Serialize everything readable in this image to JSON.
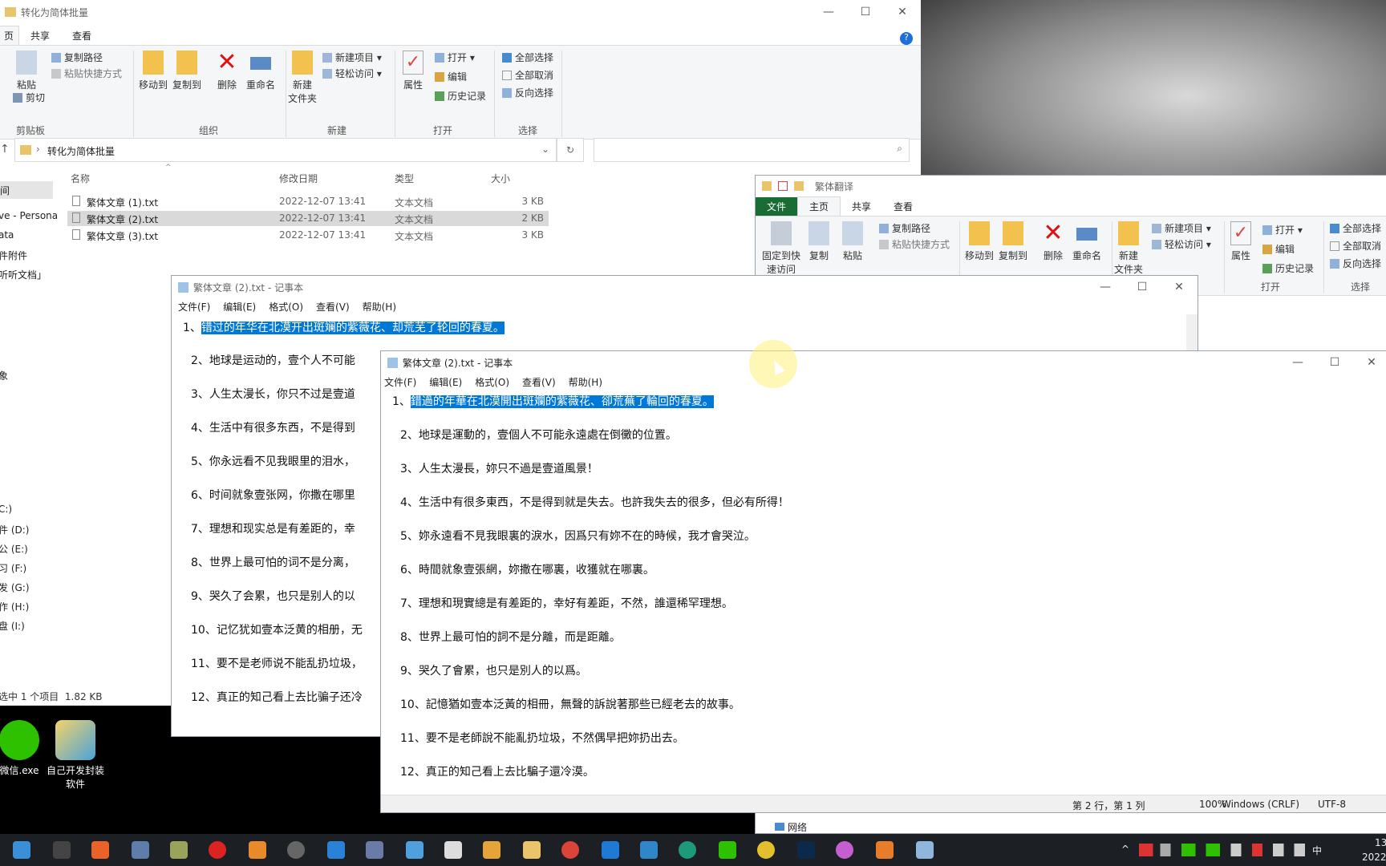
{
  "explorer_main": {
    "title": "转化为简体批量",
    "tabs": [
      "页",
      "共享",
      "查看"
    ],
    "ribbon": {
      "clipboard": {
        "copy_path": "复制路径",
        "paste_shortcut": "粘贴快捷方式",
        "paste": "粘贴",
        "cut": "剪切",
        "group": "剪贴板"
      },
      "organize": {
        "move_to": "移动到",
        "copy_to": "复制到",
        "delete": "删除",
        "rename": "重命名",
        "group": "组织"
      },
      "new": {
        "new_folder_1": "新建",
        "new_folder_2": "文件夹",
        "new_item": "新建项目",
        "easy_access": "轻松访问",
        "group": "新建"
      },
      "open": {
        "properties": "属性",
        "open": "打开",
        "edit": "编辑",
        "history": "历史记录",
        "group": "打开"
      },
      "select": {
        "select_all": "全部选择",
        "select_none": "全部取消",
        "invert": "反向选择",
        "group": "选择"
      }
    },
    "address": "转化为简体批量",
    "columns": {
      "name": "名称",
      "date": "修改日期",
      "type": "类型",
      "size": "大小"
    },
    "files": [
      {
        "name": "繁体文章 (1).txt",
        "date": "2022-12-07 13:41",
        "type": "文本文档",
        "size": "3 KB"
      },
      {
        "name": "繁体文章 (2).txt",
        "date": "2022-12-07 13:41",
        "type": "文本文档",
        "size": "2 KB"
      },
      {
        "name": "繁体文章 (3).txt",
        "date": "2022-12-07 13:41",
        "type": "文本文档",
        "size": "3 KB"
      }
    ],
    "nav": [
      "间",
      "ve - Persona",
      "ata",
      "件附件",
      "听听文档」",
      "象",
      "C:)",
      "件 (D:)",
      "公 (E:)",
      "习 (F:)",
      "发 (G:)",
      "作 (H:)",
      "盘 (I:)"
    ],
    "status": "选中 1 个项目  1.82 KB"
  },
  "explorer_second": {
    "title": "繁体翻译",
    "tabs": [
      "文件",
      "主页",
      "共享",
      "查看"
    ],
    "ribbon": {
      "pin": "固定到快",
      "pin2": "速访问",
      "copy": "复制",
      "paste": "粘贴",
      "copy_path": "复制路径",
      "paste_shortcut": "粘贴快捷方式",
      "move_to": "移动到",
      "copy_to": "复制到",
      "delete": "删除",
      "rename": "重命名",
      "new_folder": "新建",
      "new_folder2": "文件夹",
      "new_item": "新建项目",
      "easy_access": "轻松访问",
      "properties": "属性",
      "open": "打开",
      "edit": "编辑",
      "history": "历史记录",
      "group_open": "打开",
      "select_all": "全部选择",
      "select_none": "全部取消",
      "invert": "反向选择",
      "group_select": "选择"
    },
    "network": "网络"
  },
  "notepad_back": {
    "title": "繁体文章 (2).txt - 记事本",
    "menu": [
      "文件(F)",
      "编辑(E)",
      "格式(O)",
      "查看(V)",
      "帮助(H)"
    ],
    "lines": [
      {
        "num": "1、",
        "text": "错过的年华在北漠开出斑斓的紫薇花、却荒芜了轮回的春夏。"
      },
      {
        "num": "2、",
        "text": "地球是运动的，壹个人不可能"
      },
      {
        "num": "3、",
        "text": "人生太漫长，你只不过是壹道"
      },
      {
        "num": "4、",
        "text": "生活中有很多东西，不是得到"
      },
      {
        "num": "5、",
        "text": "你永远看不见我眼里的泪水，"
      },
      {
        "num": "6、",
        "text": "时间就象壹张网，你撒在哪里"
      },
      {
        "num": "7、",
        "text": "理想和现实总是有差距的，幸"
      },
      {
        "num": "8、",
        "text": "世界上最可怕的词不是分离，"
      },
      {
        "num": "9、",
        "text": "哭久了会累，也只是别人的以"
      },
      {
        "num": "10、",
        "text": "记忆犹如壹本泛黄的相册，无"
      },
      {
        "num": "11、",
        "text": "要不是老师说不能乱扔垃圾，"
      },
      {
        "num": "12、",
        "text": "真正的知己看上去比骗子还冷"
      }
    ]
  },
  "notepad_front": {
    "title": "繁体文章 (2).txt - 记事本",
    "menu": [
      "文件(F)",
      "编辑(E)",
      "格式(O)",
      "查看(V)",
      "帮助(H)"
    ],
    "lines": [
      {
        "num": "1、",
        "text": "錯過的年華在北漠開出斑斕的紫薇花、卻荒蕪了輪回的春夏。"
      },
      {
        "num": "2、",
        "text": "地球是運動的，壹個人不可能永遠處在倒黴的位置。"
      },
      {
        "num": "3、",
        "text": "人生太漫長，妳只不過是壹道風景！"
      },
      {
        "num": "4、",
        "text": "生活中有很多東西，不是得到就是失去。也許我失去的很多，但必有所得！"
      },
      {
        "num": "5、",
        "text": "妳永遠看不見我眼裏的淚水，因爲只有妳不在的時候，我才會哭泣。"
      },
      {
        "num": "6、",
        "text": "時間就象壹張網，妳撒在哪裏，收獲就在哪裏。"
      },
      {
        "num": "7、",
        "text": "理想和現實總是有差距的，幸好有差距，不然，誰還稀罕理想。"
      },
      {
        "num": "8、",
        "text": "世界上最可怕的詞不是分離，而是距離。"
      },
      {
        "num": "9、",
        "text": "哭久了會累，也只是別人的以爲。"
      },
      {
        "num": "10、",
        "text": "記憶猶如壹本泛黃的相冊，無聲的訴說著那些已經老去的故事。"
      },
      {
        "num": "11、",
        "text": "要不是老師說不能亂扔垃圾，不然偶早把妳扔出去。"
      },
      {
        "num": "12、",
        "text": "真正的知己看上去比騙子還冷漠。"
      }
    ],
    "status": {
      "position": "第 2 行，第 1 列",
      "zoom": "100%",
      "eol": "Windows (CRLF)",
      "encoding": "UTF-8"
    }
  },
  "desktop": {
    "icons": [
      {
        "label": "微信.exe"
      },
      {
        "label": "自己开发封装",
        "label2": "软件"
      }
    ]
  },
  "tray": {
    "ime": "中",
    "time": "13",
    "date": "2022"
  },
  "colors": {
    "selection": "#0078d7",
    "file_tab": "#1a6c35",
    "taskbar": "#1c2024"
  }
}
